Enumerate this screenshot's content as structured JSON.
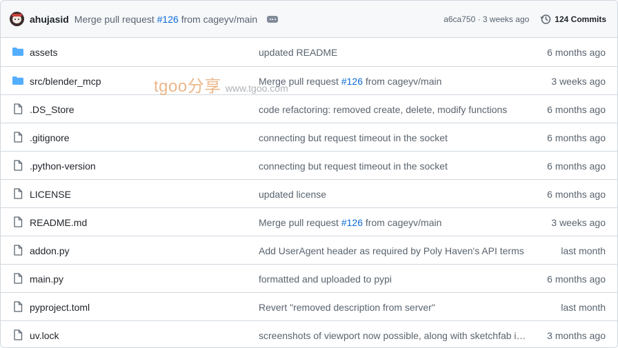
{
  "latest_commit": {
    "author": "ahujasid",
    "message_prefix": "Merge pull request",
    "pr_ref": "#126",
    "message_suffix": "from cageyv/main",
    "meta": "a6ca750 · 3 weeks ago",
    "commits_label": "124 Commits"
  },
  "files": [
    {
      "name": "assets",
      "type": "folder",
      "commit": "updated README",
      "pr": "",
      "commit_suffix": "",
      "time": "6 months ago"
    },
    {
      "name": "src/blender_mcp",
      "type": "folder",
      "commit": "Merge pull request ",
      "pr": "#126",
      "commit_suffix": " from cageyv/main",
      "time": "3 weeks ago"
    },
    {
      "name": ".DS_Store",
      "type": "file",
      "commit": "code refactoring: removed create, delete, modify functions",
      "pr": "",
      "commit_suffix": "",
      "time": "6 months ago"
    },
    {
      "name": ".gitignore",
      "type": "file",
      "commit": "connecting but request timeout in the socket",
      "pr": "",
      "commit_suffix": "",
      "time": "6 months ago"
    },
    {
      "name": ".python-version",
      "type": "file",
      "commit": "connecting but request timeout in the socket",
      "pr": "",
      "commit_suffix": "",
      "time": "6 months ago"
    },
    {
      "name": "LICENSE",
      "type": "file",
      "commit": "updated license",
      "pr": "",
      "commit_suffix": "",
      "time": "6 months ago"
    },
    {
      "name": "README.md",
      "type": "file",
      "commit": "Merge pull request ",
      "pr": "#126",
      "commit_suffix": " from cageyv/main",
      "time": "3 weeks ago"
    },
    {
      "name": "addon.py",
      "type": "file",
      "commit": "Add UserAgent header as required by Poly Haven's API terms",
      "pr": "",
      "commit_suffix": "",
      "time": "last month"
    },
    {
      "name": "main.py",
      "type": "file",
      "commit": "formatted and uploaded to pypi",
      "pr": "",
      "commit_suffix": "",
      "time": "6 months ago"
    },
    {
      "name": "pyproject.toml",
      "type": "file",
      "commit": "Revert \"removed description from server\"",
      "pr": "",
      "commit_suffix": "",
      "time": "last month"
    },
    {
      "name": "uv.lock",
      "type": "file",
      "commit": "screenshots of viewport now possible, along with sketchfab i…",
      "pr": "",
      "commit_suffix": "",
      "time": "3 months ago"
    }
  ],
  "watermark": {
    "brand": "tgoo分享",
    "url": "www.tgoo.com"
  },
  "colors": {
    "folder": "#54aeff",
    "link": "#0969da",
    "muted": "#59636e",
    "border": "#d0d7de",
    "header_bg": "#f6f8fa"
  }
}
